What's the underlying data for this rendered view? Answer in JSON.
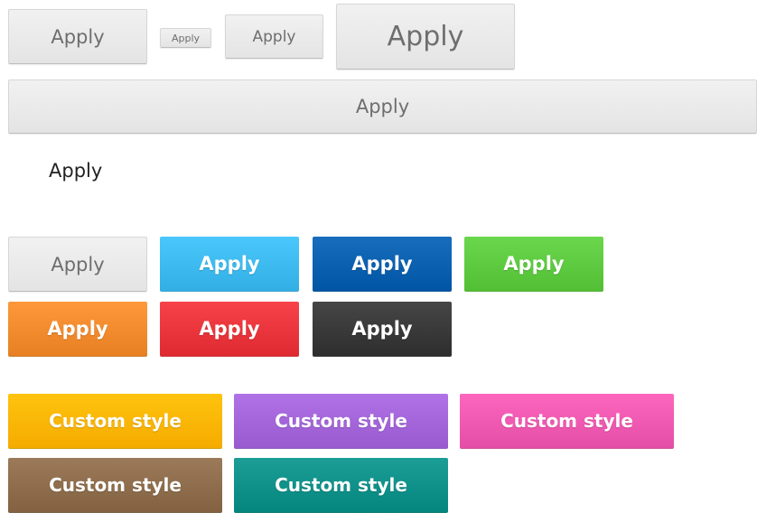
{
  "buttons": {
    "medium": "Apply",
    "mini": "Apply",
    "small": "Apply",
    "large": "Apply",
    "block": "Apply",
    "link": "Apply",
    "default": "Apply",
    "info": "Apply",
    "primary": "Apply",
    "success": "Apply",
    "warning": "Apply",
    "danger": "Apply",
    "inverse": "Apply"
  },
  "custom_buttons": {
    "yellow": "Custom style",
    "purple": "Custom style",
    "pink": "Custom style",
    "brown": "Custom style",
    "teal": "Custom style"
  },
  "colors": {
    "info": "#3cb9ee",
    "primary": "#0a5fae",
    "success": "#5cc93f",
    "warning": "#f08a2c",
    "danger": "#e8343a",
    "inverse": "#383838",
    "yellow": "#ffb500",
    "purple": "#a264d8",
    "pink": "#ef58b0",
    "brown": "#8d6c4b",
    "teal": "#0e9089"
  }
}
